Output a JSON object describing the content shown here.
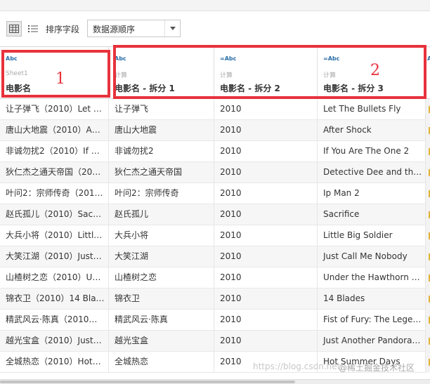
{
  "toolbar": {
    "sort_label": "排序字段",
    "sort_select_value": "数据源顺序"
  },
  "columns": [
    {
      "type": "Abc",
      "source": "Sheet1",
      "name": "电影名"
    },
    {
      "type": "Abc",
      "source": "计算",
      "name": "电影名 - 拆分 1"
    },
    {
      "type": "=Abc",
      "source": "计算",
      "name": "电影名 - 拆分 2"
    },
    {
      "type": "=Abc",
      "source": "计算",
      "name": "电影名 - 拆分 3"
    },
    {
      "type": "A",
      "source": "",
      "name": ""
    }
  ],
  "rows": [
    [
      "让子弹飞（2010）Let …",
      "让子弹飞",
      "2010",
      "Let The Bullets Fly"
    ],
    [
      "唐山大地震（2010）A…",
      "唐山大地震",
      "2010",
      "After Shock"
    ],
    [
      "非诚勿扰2（2010）If …",
      "非诚勿扰2",
      "2010",
      "If You Are The One 2"
    ],
    [
      "狄仁杰之通天帝国（20…",
      "狄仁杰之通天帝国",
      "2010",
      "Detective Dee and th…"
    ],
    [
      "叶问2：宗师传奇（201…",
      "叶问2：宗师传奇",
      "2010",
      "Ip Man 2"
    ],
    [
      "赵氏孤儿（2010）Sac…",
      "赵氏孤儿",
      "2010",
      "Sacrifice"
    ],
    [
      "大兵小将（2010）Littl…",
      "大兵小将",
      "2010",
      "Little Big Soldier"
    ],
    [
      "大笑江湖（2010）Just…",
      "大笑江湖",
      "2010",
      "Just Call Me Nobody"
    ],
    [
      "山楂树之恋（2010）U…",
      "山楂树之恋",
      "2010",
      "Under the Hawthorn …"
    ],
    [
      "锦衣卫（2010）14 Bla…",
      "锦衣卫",
      "2010",
      "14 Blades"
    ],
    [
      "精武风云·陈真（2010…",
      "精武风云·陈真",
      "2010",
      "Fist of Fury: The Lege…"
    ],
    [
      "越光宝盒（2010）Just…",
      "越光宝盒",
      "2010",
      "Just Another Pandora…"
    ],
    [
      "全城热恋（2010）Hot…",
      "全城热恋",
      "2010",
      "Hot Summer Days"
    ]
  ],
  "annotations": {
    "label_1": "1",
    "label_2": "2"
  },
  "watermark": {
    "url": "https://blog.csdn.net/",
    "brand": "@稀土掘金技术社区"
  },
  "colors": {
    "annotation_red": "#e8323c",
    "type_blue": "#2a6ea8"
  }
}
